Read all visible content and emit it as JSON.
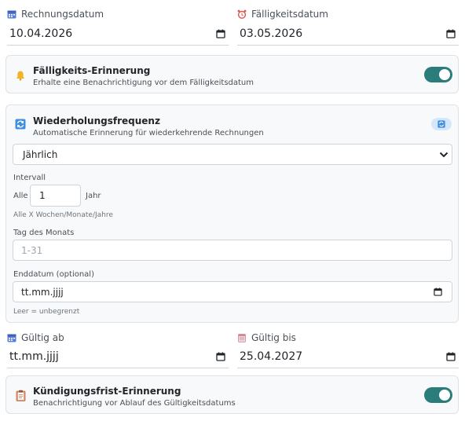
{
  "invoice_date": {
    "label": "Rechnungsdatum",
    "value": "10.04.2026"
  },
  "due_date": {
    "label": "Fälligkeitsdatum",
    "value": "03.05.2026"
  },
  "due_reminder": {
    "title": "Fälligkeits-Erinnerung",
    "subtitle": "Erhalte eine Benachrichtigung vor dem Fälligkeitsdatum",
    "enabled": true
  },
  "recurrence": {
    "title": "Wiederholungsfrequenz",
    "subtitle": "Automatische Erinnerung für wiederkehrende Rechnungen",
    "frequency": "Jährlich",
    "interval_label": "Intervall",
    "interval_prefix": "Alle",
    "interval_value": "1",
    "interval_unit": "Jahr",
    "interval_hint": "Alle X Wochen/Monate/Jahre",
    "day_label": "Tag des Monats",
    "day_placeholder": "1-31",
    "end_label": "Enddatum (optional)",
    "end_value": "tt.mm.jjjj",
    "end_hint": "Leer = unbegrenzt"
  },
  "valid_from": {
    "label": "Gültig ab",
    "value": "tt.mm.jjjj"
  },
  "valid_until": {
    "label": "Gültig bis",
    "value": "25.04.2027"
  },
  "cancellation_reminder": {
    "title": "Kündigungsfrist-Erinnerung",
    "subtitle": "Benachrichtigung vor Ablauf des Gültigkeitsdatums",
    "enabled": true
  },
  "colors": {
    "accent": "#2a7d7a",
    "card_bg": "#f8f9fa",
    "border": "#dee2e6"
  }
}
